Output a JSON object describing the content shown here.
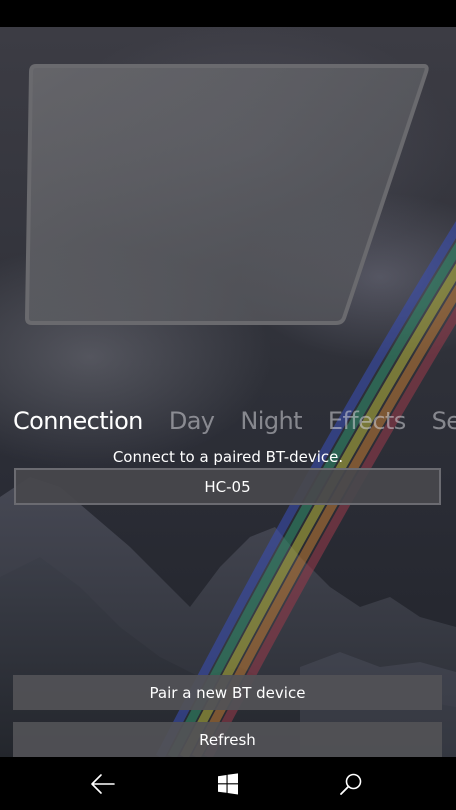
{
  "pivot": {
    "tabs": [
      {
        "label": "Connection",
        "active": true
      },
      {
        "label": "Day",
        "active": false
      },
      {
        "label": "Night",
        "active": false
      },
      {
        "label": "Effects",
        "active": false
      },
      {
        "label": "Se",
        "active": false
      }
    ]
  },
  "connection": {
    "prompt": "Connect to a paired BT-device.",
    "selected_device": "HC-05",
    "pair_button": "Pair a new BT device",
    "refresh_button": "Refresh"
  },
  "navbar": {
    "back_icon": "back-arrow-icon",
    "start_icon": "windows-logo-icon",
    "search_icon": "search-icon"
  },
  "colors": {
    "accent_text": "#ffffff",
    "inactive_tab": "#8c8c92",
    "button_bg": "#525256"
  }
}
